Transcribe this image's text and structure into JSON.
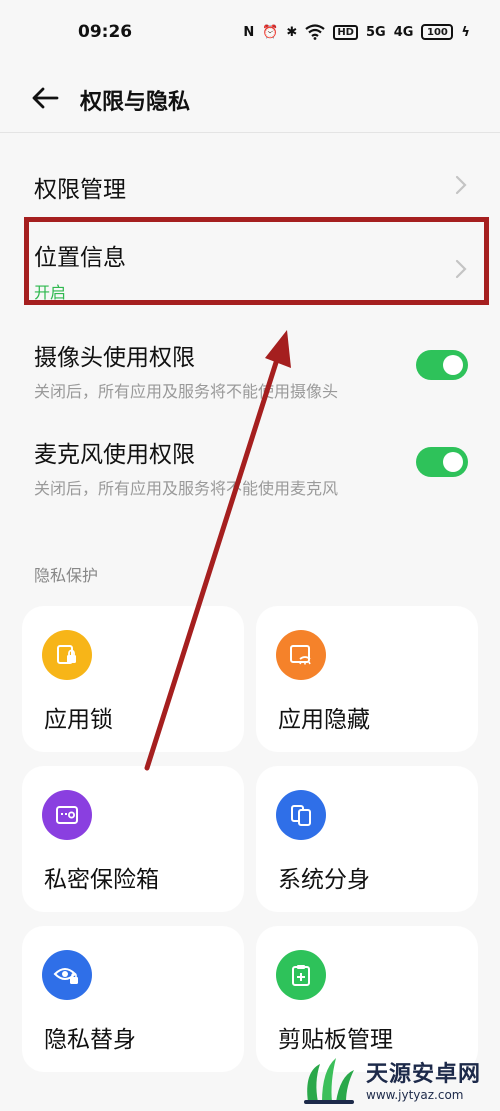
{
  "status_bar": {
    "time": "09:26",
    "nfc": "N",
    "hd": "HD",
    "signal1": "5G",
    "signal2": "4G",
    "battery": "100"
  },
  "header": {
    "title": "权限与隐私"
  },
  "rows": {
    "permission": {
      "title": "权限管理"
    },
    "location": {
      "title": "位置信息",
      "status": "开启"
    },
    "camera": {
      "title": "摄像头使用权限",
      "desc": "关闭后，所有应用及服务将不能使用摄像头",
      "enabled": true
    },
    "mic": {
      "title": "麦克风使用权限",
      "desc": "关闭后，所有应用及服务将不能使用麦克风",
      "enabled": true
    }
  },
  "section": {
    "label": "隐私保护"
  },
  "cards": {
    "app_lock": {
      "label": "应用锁",
      "color": "#f7b518"
    },
    "app_hide": {
      "label": "应用隐藏",
      "color": "#f5822a"
    },
    "vault": {
      "label": "私密保险箱",
      "color": "#8a3fe0"
    },
    "clone": {
      "label": "系统分身",
      "color": "#2f6fe8"
    },
    "privacy_id": {
      "label": "隐私替身",
      "color": "#2f6fe8"
    },
    "clipboard": {
      "label": "剪贴板管理",
      "color": "#2ec25a"
    }
  },
  "accent": {
    "highlight": "#a51f1f",
    "toggle_on": "#2ec25a"
  },
  "watermark": {
    "name": "天源安卓网",
    "url": "www.jytyaz.com"
  }
}
